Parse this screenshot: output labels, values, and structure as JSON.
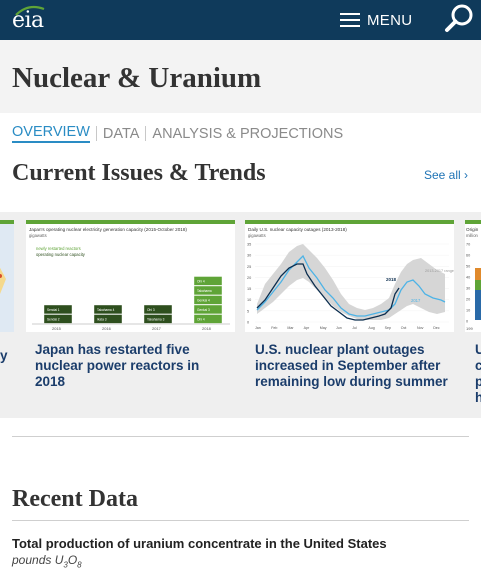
{
  "header": {
    "logo_text": "eia",
    "menu_label": "MENU",
    "colors": {
      "bar": "#0f3a5b",
      "accent": "#5fa437",
      "link": "#1e73b5"
    }
  },
  "page": {
    "title": "Nuclear & Uranium"
  },
  "subnav": {
    "tabs": [
      {
        "label": "OVERVIEW",
        "active": true
      },
      {
        "label": "DATA",
        "active": false
      },
      {
        "label": "ANALYSIS & PROJECTIONS",
        "active": false
      }
    ]
  },
  "issues": {
    "title": "Current Issues & Trends",
    "see_all": "See all",
    "cards": [
      {
        "caption": "Japan has restarted five nuclear power reactors in 2018",
        "chart_title": "Japan's operating nuclear electricity generation capacity (2015-October 2018)",
        "chart_unit": "gigawatts",
        "legend": [
          "newly restarted reactors",
          "operating nuclear capacity"
        ],
        "x_labels": [
          "2015",
          "2016",
          "2017",
          "2018"
        ],
        "segments": [
          [
            "Sendai 2",
            "Sendai 1"
          ],
          [
            "Ikata 3",
            "Takahama 4"
          ],
          [
            "Takahama 3",
            "Ohi 3"
          ],
          [
            "Ohi 4",
            "Genkai 3",
            "Genkai 4",
            "Takahama",
            "Ohi 4"
          ]
        ]
      },
      {
        "caption": "U.S. nuclear plant outages increased in September after remaining low during summer",
        "chart_title": "Daily U.S. nuclear capacity outages (2013-2018)",
        "chart_unit": "gigawatts",
        "y_labels": [
          "35",
          "30",
          "25",
          "20",
          "15",
          "10",
          "5",
          "0"
        ],
        "x_labels": [
          "Jan",
          "Feb",
          "Mar",
          "Apr",
          "May",
          "Jun",
          "Jul",
          "Aug",
          "Sep",
          "Oct",
          "Nov",
          "Dec"
        ],
        "series_labels": [
          "2018",
          "2017",
          "2013-2017 range"
        ]
      }
    ],
    "partial_left_caption": "y",
    "partial_right": {
      "caption_letters": [
        "U",
        "c",
        "p",
        "h"
      ],
      "chart_title": "Origin",
      "chart_unit": "million",
      "y_labels": [
        "70",
        "60",
        "50",
        "40",
        "30",
        "20",
        "10",
        "0"
      ],
      "x_label": "199"
    }
  },
  "recent": {
    "title": "Recent Data",
    "item_title": "Total production of uranium concentrate in the United States",
    "unit_prefix": "pounds U",
    "unit_sub1": "3",
    "unit_mid": "O",
    "unit_sub2": "8"
  }
}
